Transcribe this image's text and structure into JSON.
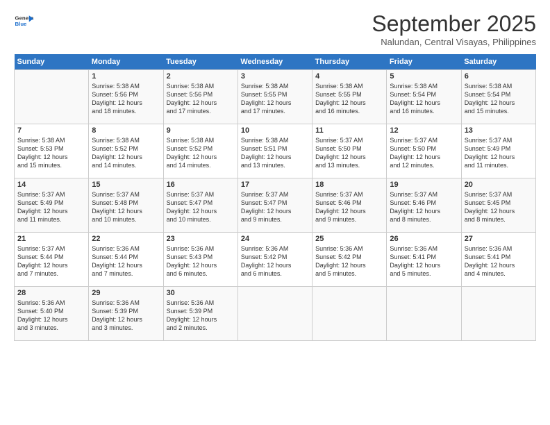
{
  "logo": {
    "general": "General",
    "blue": "Blue"
  },
  "title": "September 2025",
  "subtitle": "Nalundan, Central Visayas, Philippines",
  "weekdays": [
    "Sunday",
    "Monday",
    "Tuesday",
    "Wednesday",
    "Thursday",
    "Friday",
    "Saturday"
  ],
  "weeks": [
    [
      {
        "day": "",
        "info": ""
      },
      {
        "day": "1",
        "info": "Sunrise: 5:38 AM\nSunset: 5:56 PM\nDaylight: 12 hours\nand 18 minutes."
      },
      {
        "day": "2",
        "info": "Sunrise: 5:38 AM\nSunset: 5:56 PM\nDaylight: 12 hours\nand 17 minutes."
      },
      {
        "day": "3",
        "info": "Sunrise: 5:38 AM\nSunset: 5:55 PM\nDaylight: 12 hours\nand 17 minutes."
      },
      {
        "day": "4",
        "info": "Sunrise: 5:38 AM\nSunset: 5:55 PM\nDaylight: 12 hours\nand 16 minutes."
      },
      {
        "day": "5",
        "info": "Sunrise: 5:38 AM\nSunset: 5:54 PM\nDaylight: 12 hours\nand 16 minutes."
      },
      {
        "day": "6",
        "info": "Sunrise: 5:38 AM\nSunset: 5:54 PM\nDaylight: 12 hours\nand 15 minutes."
      }
    ],
    [
      {
        "day": "7",
        "info": "Sunrise: 5:38 AM\nSunset: 5:53 PM\nDaylight: 12 hours\nand 15 minutes."
      },
      {
        "day": "8",
        "info": "Sunrise: 5:38 AM\nSunset: 5:52 PM\nDaylight: 12 hours\nand 14 minutes."
      },
      {
        "day": "9",
        "info": "Sunrise: 5:38 AM\nSunset: 5:52 PM\nDaylight: 12 hours\nand 14 minutes."
      },
      {
        "day": "10",
        "info": "Sunrise: 5:38 AM\nSunset: 5:51 PM\nDaylight: 12 hours\nand 13 minutes."
      },
      {
        "day": "11",
        "info": "Sunrise: 5:37 AM\nSunset: 5:50 PM\nDaylight: 12 hours\nand 13 minutes."
      },
      {
        "day": "12",
        "info": "Sunrise: 5:37 AM\nSunset: 5:50 PM\nDaylight: 12 hours\nand 12 minutes."
      },
      {
        "day": "13",
        "info": "Sunrise: 5:37 AM\nSunset: 5:49 PM\nDaylight: 12 hours\nand 11 minutes."
      }
    ],
    [
      {
        "day": "14",
        "info": "Sunrise: 5:37 AM\nSunset: 5:49 PM\nDaylight: 12 hours\nand 11 minutes."
      },
      {
        "day": "15",
        "info": "Sunrise: 5:37 AM\nSunset: 5:48 PM\nDaylight: 12 hours\nand 10 minutes."
      },
      {
        "day": "16",
        "info": "Sunrise: 5:37 AM\nSunset: 5:47 PM\nDaylight: 12 hours\nand 10 minutes."
      },
      {
        "day": "17",
        "info": "Sunrise: 5:37 AM\nSunset: 5:47 PM\nDaylight: 12 hours\nand 9 minutes."
      },
      {
        "day": "18",
        "info": "Sunrise: 5:37 AM\nSunset: 5:46 PM\nDaylight: 12 hours\nand 9 minutes."
      },
      {
        "day": "19",
        "info": "Sunrise: 5:37 AM\nSunset: 5:46 PM\nDaylight: 12 hours\nand 8 minutes."
      },
      {
        "day": "20",
        "info": "Sunrise: 5:37 AM\nSunset: 5:45 PM\nDaylight: 12 hours\nand 8 minutes."
      }
    ],
    [
      {
        "day": "21",
        "info": "Sunrise: 5:37 AM\nSunset: 5:44 PM\nDaylight: 12 hours\nand 7 minutes."
      },
      {
        "day": "22",
        "info": "Sunrise: 5:36 AM\nSunset: 5:44 PM\nDaylight: 12 hours\nand 7 minutes."
      },
      {
        "day": "23",
        "info": "Sunrise: 5:36 AM\nSunset: 5:43 PM\nDaylight: 12 hours\nand 6 minutes."
      },
      {
        "day": "24",
        "info": "Sunrise: 5:36 AM\nSunset: 5:42 PM\nDaylight: 12 hours\nand 6 minutes."
      },
      {
        "day": "25",
        "info": "Sunrise: 5:36 AM\nSunset: 5:42 PM\nDaylight: 12 hours\nand 5 minutes."
      },
      {
        "day": "26",
        "info": "Sunrise: 5:36 AM\nSunset: 5:41 PM\nDaylight: 12 hours\nand 5 minutes."
      },
      {
        "day": "27",
        "info": "Sunrise: 5:36 AM\nSunset: 5:41 PM\nDaylight: 12 hours\nand 4 minutes."
      }
    ],
    [
      {
        "day": "28",
        "info": "Sunrise: 5:36 AM\nSunset: 5:40 PM\nDaylight: 12 hours\nand 3 minutes."
      },
      {
        "day": "29",
        "info": "Sunrise: 5:36 AM\nSunset: 5:39 PM\nDaylight: 12 hours\nand 3 minutes."
      },
      {
        "day": "30",
        "info": "Sunrise: 5:36 AM\nSunset: 5:39 PM\nDaylight: 12 hours\nand 2 minutes."
      },
      {
        "day": "",
        "info": ""
      },
      {
        "day": "",
        "info": ""
      },
      {
        "day": "",
        "info": ""
      },
      {
        "day": "",
        "info": ""
      }
    ]
  ]
}
